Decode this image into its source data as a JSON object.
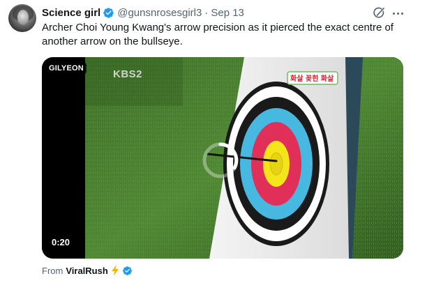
{
  "tweet": {
    "author": {
      "name": "Science girl",
      "handle": "@gunsnrosesgirl3",
      "verified": true
    },
    "separator": "·",
    "date": "Sep 13",
    "text": "Archer Choi Young Kwang's arrow precision as it pierced the exact centre of another arrow on the bullseye.",
    "media": {
      "source_tag": "GILYEON",
      "channel_watermark": "KBS2",
      "duration": "0:20"
    },
    "from": {
      "label": "From",
      "name": "ViralRush"
    },
    "colors": {
      "verified_blue": "#1d9bf0",
      "bolt_yellow": "#f5b400",
      "secondary_text": "#536471"
    },
    "icons": [
      "verified-badge-icon",
      "grok-icon",
      "more-icon",
      "lightning-bolt-icon",
      "loading-spinner-icon"
    ]
  }
}
